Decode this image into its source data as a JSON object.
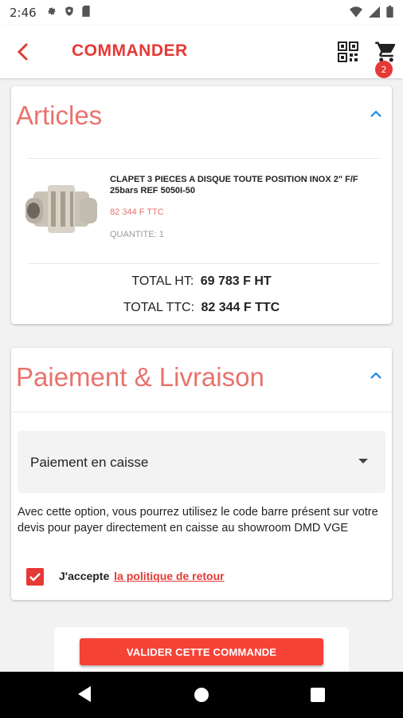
{
  "status_bar": {
    "time": "2:46",
    "icons": [
      "settings-icon",
      "shield-icon",
      "sd-card-icon",
      "wifi-icon",
      "signal-icon",
      "battery-icon"
    ]
  },
  "app_bar": {
    "title": "COMMANDER",
    "cart_badge": "2",
    "accent_color": "#e53935"
  },
  "articles": {
    "title": "Articles",
    "item": {
      "name": "CLAPET 3 PIECES A DISQUE TOUTE POSITION INOX 2\" F/F 25bars REF 5050I-50",
      "price": "82 344 F TTC",
      "quantity": "QUANTITE: 1"
    },
    "total_ht_label": "TOTAL HT:",
    "total_ht_value": "69  783 F HT",
    "total_ttc_label": "TOTAL TTC:",
    "total_ttc_value": "82  344 F TTC"
  },
  "payment": {
    "title": "Paiement & Livraison",
    "selected_option": "Paiement en caisse",
    "description": "Avec cette option, vous pourrez utilisez le code barre présent sur votre devis pour payer directement en caisse au showroom DMD VGE",
    "accept_text": "J'accepte",
    "policy_link": "la politique de retour",
    "accepted": true
  },
  "actions": {
    "validate_label": "VALIDER CETTE COMMANDE"
  }
}
